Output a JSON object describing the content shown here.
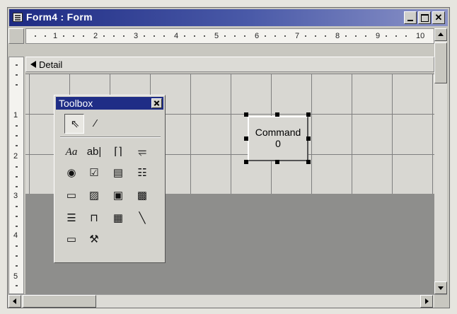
{
  "window": {
    "title": "Form4 : Form"
  },
  "ruler": {
    "h_numbers": [
      "1",
      "2",
      "3",
      "4",
      "5",
      "6",
      "7",
      "8",
      "9",
      "10"
    ],
    "v_numbers": [
      "1",
      "2",
      "3",
      "4",
      "5"
    ]
  },
  "section": {
    "label": "Detail"
  },
  "command_button": {
    "line1": "Command",
    "line2": "0"
  },
  "toolbox": {
    "title": "Toolbox",
    "tools": [
      {
        "name": "select-objects-icon",
        "glyph": "⇖"
      },
      {
        "name": "control-wizards-icon",
        "glyph": "⁄"
      },
      {
        "name": "label-icon",
        "glyph": "Aa"
      },
      {
        "name": "text-box-icon",
        "glyph": "ab|"
      },
      {
        "name": "option-group-icon",
        "glyph": "⌈⌉"
      },
      {
        "name": "toggle-button-icon",
        "glyph": "⥫"
      },
      {
        "name": "option-button-icon",
        "glyph": "◉"
      },
      {
        "name": "check-box-icon",
        "glyph": "☑"
      },
      {
        "name": "combo-box-icon",
        "glyph": "▤"
      },
      {
        "name": "list-box-icon",
        "glyph": "☷"
      },
      {
        "name": "command-button-icon",
        "glyph": "▭"
      },
      {
        "name": "image-icon",
        "glyph": "▨"
      },
      {
        "name": "unbound-object-frame-icon",
        "glyph": "▣"
      },
      {
        "name": "bound-object-frame-icon",
        "glyph": "▩"
      },
      {
        "name": "page-break-icon",
        "glyph": "☰"
      },
      {
        "name": "tab-control-icon",
        "glyph": "⊓"
      },
      {
        "name": "subform-icon",
        "glyph": "▦"
      },
      {
        "name": "line-icon",
        "glyph": "╲"
      },
      {
        "name": "rectangle-icon",
        "glyph": "▭"
      },
      {
        "name": "more-controls-icon",
        "glyph": "⚒"
      }
    ]
  }
}
